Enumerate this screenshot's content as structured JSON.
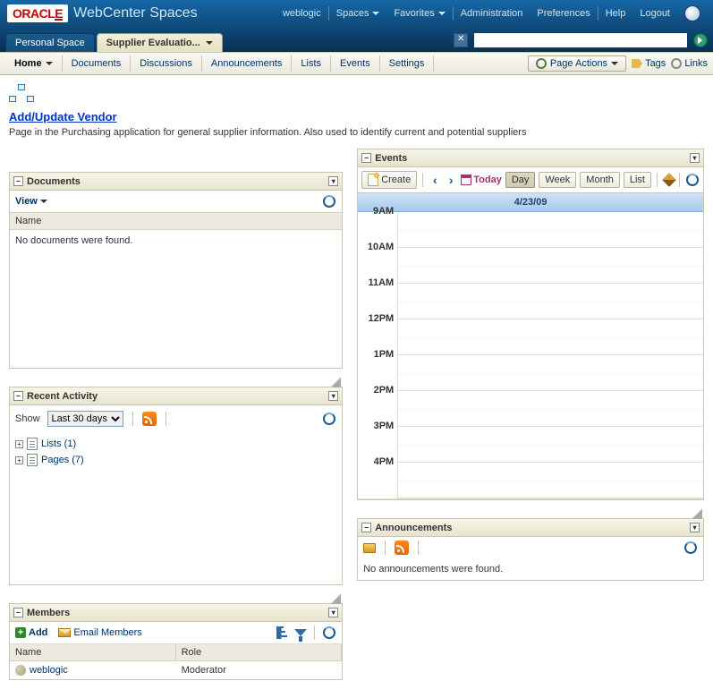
{
  "banner": {
    "brand_prefix": "ORACL",
    "brand_e": "E",
    "app": "WebCenter Spaces",
    "user": "weblogic",
    "menus": {
      "spaces": "Spaces",
      "favorites": "Favorites"
    },
    "links": {
      "admin": "Administration",
      "prefs": "Preferences",
      "help": "Help",
      "logout": "Logout"
    }
  },
  "tabs": {
    "personal": "Personal Space",
    "active": "Supplier Evaluatio..."
  },
  "toolbar": {
    "items": {
      "home": "Home",
      "documents": "Documents",
      "discussions": "Discussions",
      "announcements": "Announcements",
      "lists": "Lists",
      "events": "Events",
      "settings": "Settings"
    },
    "page_actions": "Page Actions",
    "tags": "Tags",
    "links": "Links"
  },
  "page": {
    "title": "Add/Update Vendor",
    "subtitle": "Page in the Purchasing application for general supplier information. Also used to identify current and potential suppliers"
  },
  "documents": {
    "heading": "Documents",
    "view": "View",
    "column_name": "Name",
    "empty": "No documents were found."
  },
  "activity": {
    "heading": "Recent Activity",
    "show_label": "Show",
    "selected_range": "Last 30 days",
    "nodes": {
      "lists": "Lists (1)",
      "pages": "Pages (7)"
    }
  },
  "members": {
    "heading": "Members",
    "add": "Add",
    "email": "Email Members",
    "col_name": "Name",
    "col_role": "Role",
    "row": {
      "name": "weblogic",
      "role": "Moderator"
    }
  },
  "events": {
    "heading": "Events",
    "create": "Create",
    "today": "Today",
    "views": {
      "day": "Day",
      "week": "Week",
      "month": "Month",
      "list": "List"
    },
    "date": "4/23/09",
    "hours": [
      "9AM",
      "10AM",
      "11AM",
      "12PM",
      "1PM",
      "2PM",
      "3PM",
      "4PM"
    ]
  },
  "announcements": {
    "heading": "Announcements",
    "empty": "No announcements were found."
  }
}
